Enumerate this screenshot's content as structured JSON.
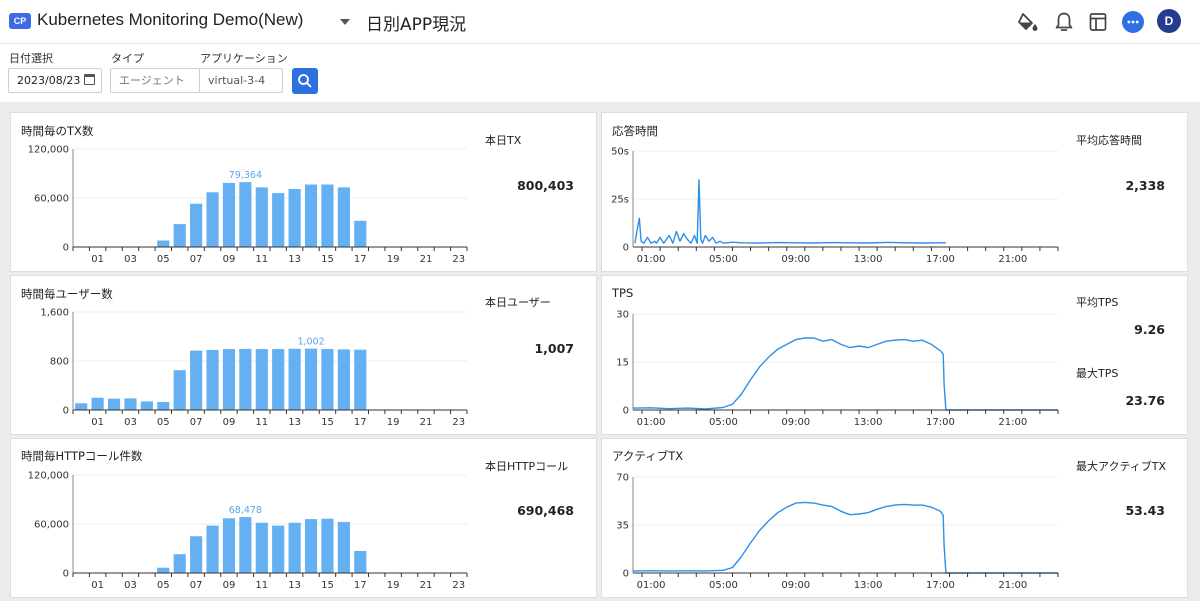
{
  "header": {
    "badge": "CP",
    "project_name": "Kubernetes Monitoring Demo(New)",
    "page_name": "日別APP現況",
    "avatar_initial": "D"
  },
  "filters": {
    "date_label": "日付選択",
    "date_value": "2023/08/23",
    "type_label": "タイプ",
    "type_value": "エージェント",
    "app_label": "アプリケーション",
    "app_value": "virtual-3-4"
  },
  "panels": {
    "tx": {
      "title": "時間毎のTX数",
      "stat_label": "本日TX",
      "stat_value": "800,403"
    },
    "users": {
      "title": "時間毎ユーザー数",
      "stat_label": "本日ユーザー",
      "stat_value": "1,007"
    },
    "http": {
      "title": "時間毎HTTPコール件数",
      "stat_label": "本日HTTPコール",
      "stat_value": "690,468"
    },
    "response": {
      "title": "応答時間",
      "stat_label": "平均応答時間",
      "stat_value": "2,338"
    },
    "tps": {
      "title": "TPS",
      "stat1_label": "平均TPS",
      "stat1_value": "9.26",
      "stat2_label": "最大TPS",
      "stat2_value": "23.76"
    },
    "active": {
      "title": "アクティブTX",
      "stat_label": "最大アクティブTX",
      "stat_value": "53.43"
    }
  },
  "colors": {
    "accent": "#2f6fe4",
    "bar": "#64b0f2",
    "line": "#2e8fe8",
    "avatar": "#243c8f"
  },
  "chart_data": [
    {
      "id": "tx",
      "type": "bar",
      "categories": [
        "00",
        "01",
        "02",
        "03",
        "04",
        "05",
        "06",
        "07",
        "08",
        "09",
        "10",
        "11",
        "12",
        "13",
        "14",
        "15",
        "16",
        "17",
        "18",
        "19",
        "20",
        "21",
        "22",
        "23"
      ],
      "tick_labels": [
        "01",
        "03",
        "05",
        "07",
        "09",
        "11",
        "13",
        "15",
        "17",
        "19",
        "21",
        "23"
      ],
      "values": [
        400,
        500,
        600,
        400,
        300,
        8000,
        28000,
        53000,
        67000,
        78500,
        79364,
        73000,
        66000,
        71000,
        76500,
        76500,
        73000,
        32000,
        0,
        0,
        0,
        0,
        0,
        0
      ],
      "ylim": [
        0,
        120000
      ],
      "yticks": [
        "0",
        "60,000",
        "120,000"
      ],
      "annotation": {
        "category": "10",
        "label": "79,364"
      }
    },
    {
      "id": "users",
      "type": "bar",
      "categories": [
        "00",
        "01",
        "02",
        "03",
        "04",
        "05",
        "06",
        "07",
        "08",
        "09",
        "10",
        "11",
        "12",
        "13",
        "14",
        "15",
        "16",
        "17",
        "18",
        "19",
        "20",
        "21",
        "22",
        "23"
      ],
      "tick_labels": [
        "01",
        "03",
        "05",
        "07",
        "09",
        "11",
        "13",
        "15",
        "17",
        "19",
        "21",
        "23"
      ],
      "values": [
        110,
        200,
        185,
        190,
        140,
        130,
        650,
        970,
        980,
        995,
        998,
        995,
        995,
        1000,
        1002,
        995,
        990,
        985,
        0,
        0,
        0,
        0,
        0,
        0
      ],
      "ylim": [
        0,
        1600
      ],
      "yticks": [
        "0",
        "800",
        "1,600"
      ],
      "annotation": {
        "category": "14",
        "label": "1,002"
      }
    },
    {
      "id": "http",
      "type": "bar",
      "categories": [
        "00",
        "01",
        "02",
        "03",
        "04",
        "05",
        "06",
        "07",
        "08",
        "09",
        "10",
        "11",
        "12",
        "13",
        "14",
        "15",
        "16",
        "17",
        "18",
        "19",
        "20",
        "21",
        "22",
        "23"
      ],
      "tick_labels": [
        "01",
        "03",
        "05",
        "07",
        "09",
        "11",
        "13",
        "15",
        "17",
        "19",
        "21",
        "23"
      ],
      "values": [
        400,
        500,
        600,
        400,
        300,
        6500,
        23000,
        45000,
        58000,
        67000,
        68478,
        61500,
        58000,
        61500,
        66000,
        66500,
        62500,
        27000,
        0,
        0,
        0,
        0,
        0,
        0
      ],
      "ylim": [
        0,
        120000
      ],
      "yticks": [
        "0",
        "60,000",
        "120,000"
      ],
      "annotation": {
        "category": "10",
        "label": "68,478"
      }
    },
    {
      "id": "response",
      "type": "line",
      "xlim": [
        0,
        23.5
      ],
      "xticks": [
        "01:00",
        "05:00",
        "09:00",
        "13:00",
        "17:00",
        "21:00"
      ],
      "ylim": [
        0,
        50
      ],
      "yticks": [
        "0",
        "25s",
        "50s"
      ],
      "x": [
        0.1,
        0.35,
        0.45,
        0.6,
        0.8,
        1.0,
        1.2,
        1.3,
        1.5,
        1.7,
        2.0,
        2.2,
        2.4,
        2.6,
        2.8,
        3.0,
        3.2,
        3.4,
        3.55,
        3.65,
        3.75,
        3.85,
        4.0,
        4.2,
        4.4,
        4.6,
        4.8,
        5.0,
        5.5,
        6.0,
        7.0,
        8.0,
        9.0,
        10.0,
        11.0,
        12.0,
        13.0,
        14.0,
        15.0,
        16.0,
        17.0,
        17.3
      ],
      "y": [
        2,
        15,
        3,
        2,
        5,
        2,
        3,
        2,
        5,
        2,
        6,
        2,
        8,
        3,
        7,
        4,
        2,
        6,
        2,
        35,
        4,
        2,
        6,
        3,
        5,
        2,
        3,
        2,
        2.5,
        2.2,
        2.1,
        2.3,
        2.2,
        2.1,
        2.3,
        2.2,
        2.1,
        2.4,
        2.2,
        2.1,
        2.2,
        2.2
      ]
    },
    {
      "id": "tps",
      "type": "line",
      "xlim": [
        0,
        23.5
      ],
      "xticks": [
        "01:00",
        "05:00",
        "09:00",
        "13:00",
        "17:00",
        "21:00"
      ],
      "ylim": [
        0,
        30
      ],
      "yticks": [
        "0",
        "15",
        "30"
      ],
      "x": [
        0,
        1,
        2,
        3,
        4,
        5,
        5.5,
        6,
        6.5,
        7,
        7.5,
        8,
        8.5,
        9,
        9.5,
        10,
        10.5,
        11,
        11.5,
        12,
        12.5,
        13,
        13.5,
        14,
        14.5,
        15,
        15.5,
        16,
        16.5,
        17,
        17.15,
        17.2,
        17.3,
        23.5
      ],
      "y": [
        0.6,
        0.7,
        0.4,
        0.6,
        0.3,
        0.8,
        1.8,
        5,
        9.5,
        13.5,
        16.5,
        19,
        20.5,
        22,
        22.5,
        22.5,
        21.5,
        22,
        20.5,
        19.5,
        20,
        19.5,
        20.5,
        21.5,
        21.8,
        22,
        21.5,
        21.8,
        20.5,
        18.5,
        17.5,
        8,
        0,
        0
      ]
    },
    {
      "id": "active",
      "type": "line",
      "xlim": [
        0,
        23.5
      ],
      "xticks": [
        "01:00",
        "05:00",
        "09:00",
        "13:00",
        "17:00",
        "21:00"
      ],
      "ylim": [
        0,
        70
      ],
      "yticks": [
        "0",
        "35",
        "70"
      ],
      "x": [
        0,
        1,
        2,
        3,
        4,
        5,
        5.5,
        6,
        6.5,
        7,
        7.5,
        8,
        8.5,
        9,
        9.5,
        10,
        10.5,
        11,
        11.5,
        12,
        12.5,
        13,
        13.5,
        14,
        14.5,
        15,
        15.5,
        16,
        16.5,
        17,
        17.15,
        17.2,
        17.3,
        23.5
      ],
      "y": [
        1.5,
        1.6,
        1.5,
        1.6,
        1.5,
        2,
        4,
        12,
        22,
        31,
        38,
        44,
        48,
        51,
        51.5,
        51,
        49.5,
        48.5,
        45,
        42.5,
        43,
        44,
        46.5,
        48.5,
        49.5,
        50,
        49.5,
        49.5,
        48,
        45,
        42,
        20,
        0,
        0
      ]
    }
  ]
}
